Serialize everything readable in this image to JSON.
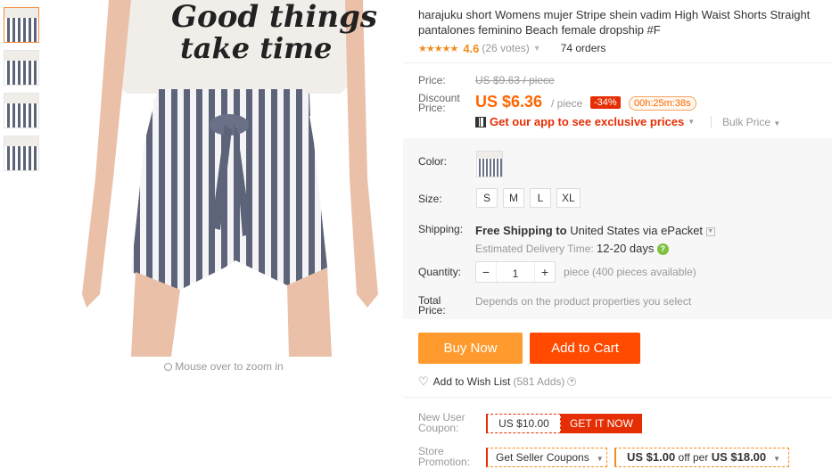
{
  "gallery": {
    "zoom_hint": "Mouse over to zoom in",
    "shirt_text_line1": "Good things",
    "shirt_text_line2": "take time"
  },
  "product": {
    "title": "harajuku short Womens mujer Stripe shein vadim High Waist Shorts Straight pantalones feminino Beach female dropship #F",
    "stars": "★★★★★",
    "rating": "4.6",
    "votes": "(26 votes)",
    "orders": "74 orders"
  },
  "price": {
    "price_label": "Price:",
    "original": "US $9.63 / piece",
    "discount_label_1": "Discount",
    "discount_label_2": "Price:",
    "discount_price": "US $6.36",
    "per_piece": "/ piece",
    "off": "-34%",
    "timer": "00h:25m:38s",
    "app_promo": "Get our app to see exclusive prices",
    "bulk_price": "Bulk Price"
  },
  "options": {
    "color_label": "Color:",
    "size_label": "Size:",
    "sizes": [
      "S",
      "M",
      "L",
      "XL"
    ],
    "shipping_label": "Shipping:",
    "shipping_free": "Free Shipping to",
    "shipping_dest": "United States via ePacket",
    "eta_label": "Estimated Delivery Time:",
    "eta_days": "12-20 days",
    "quantity_label": "Quantity:",
    "quantity": "1",
    "quantity_note": "piece (400 pieces available)",
    "total_label_1": "Total",
    "total_label_2": "Price:",
    "total_note": "Depends on the product properties you select"
  },
  "actions": {
    "buy_now": "Buy Now",
    "add_to_cart": "Add to Cart",
    "wish_list": "Add to Wish List",
    "wish_count": "(581 Adds)"
  },
  "coupons": {
    "new_user_label_1": "New User",
    "new_user_label_2": "Coupon:",
    "new_user_amount": "US $10.00",
    "get_it": "GET IT NOW",
    "store_label_1": "Store",
    "store_label_2": "Promotion:",
    "seller_coupons": "Get Seller Coupons",
    "deal_amount": "US $1.00",
    "deal_per": "off per",
    "deal_threshold": "US $18.00"
  },
  "colors": {
    "accent": "#ff6600",
    "cart": "#ff4a00",
    "buy": "#ff9a2e"
  }
}
